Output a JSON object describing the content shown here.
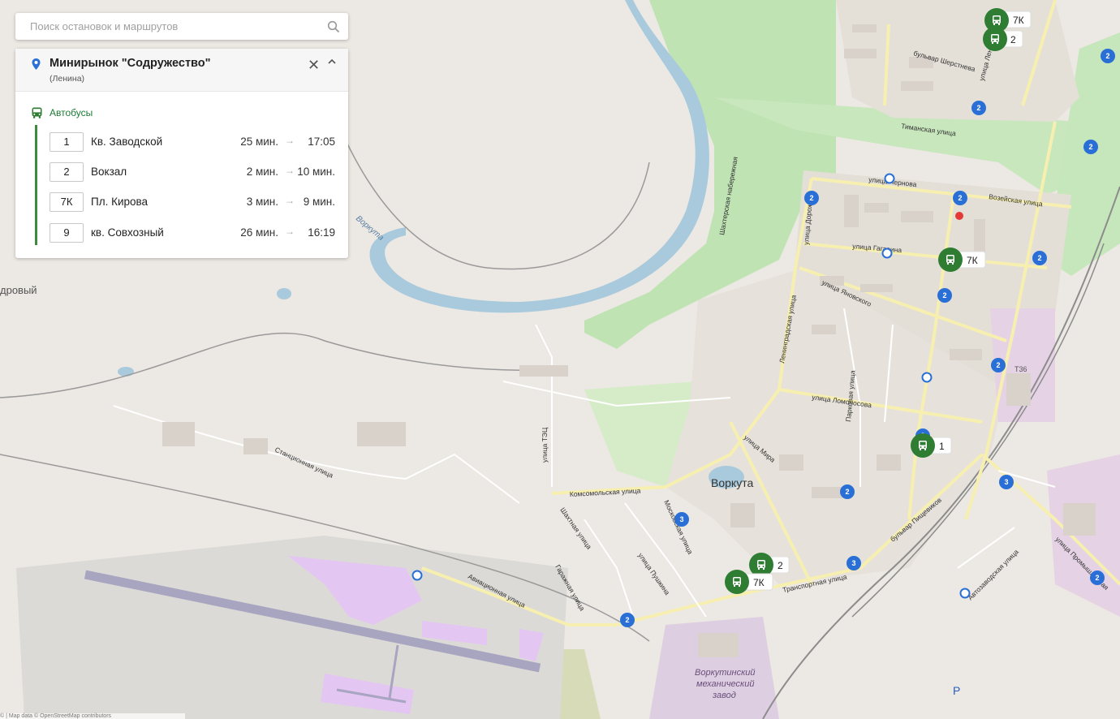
{
  "search": {
    "placeholder": "Поиск остановок и маршрутов",
    "icon": "search-icon"
  },
  "stop": {
    "title": "Минирынок \"Содружество\"",
    "subtitle": "(Ленина)",
    "section_label": "Автобусы",
    "routes": [
      {
        "number": "1",
        "destination": "Кв. Заводской",
        "next": "25 мин.",
        "after": "17:05"
      },
      {
        "number": "2",
        "destination": "Вокзал",
        "next": "2 мин.",
        "after": "10 мин."
      },
      {
        "number": "7К",
        "destination": "Пл. Кирова",
        "next": "3 мин.",
        "after": "9 мин."
      },
      {
        "number": "9",
        "destination": "кв. Совхозный",
        "next": "26 мин.",
        "after": "16:19"
      }
    ]
  },
  "map": {
    "city_label": "Воркута",
    "river_label": "Воркута",
    "district_label": "дровый",
    "factory_label": [
      "Воркутинский",
      "механический",
      "завод"
    ],
    "parking_label": "P",
    "code_label": "Т36",
    "streets": [
      "бульвар Шерстнева",
      "улица Ленина",
      "Тиманская улица",
      "улица Чернова",
      "Возейская улица",
      "улица Гагарина",
      "улица Яновского",
      "Шахтерская набережная",
      "Ленинградская улица",
      "Парковая улица",
      "улица Ломоносова",
      "бульвар Пищевиков",
      "улица Мира",
      "Комсомольская улица",
      "Московская улица",
      "улица Пушкина",
      "Шахтная улица",
      "Гаражная улица",
      "Транспортная улица",
      "Авиационная улица",
      "Станционная улица",
      "улица ТЭЦ",
      "Автозаводская улица",
      "улица Промышленная",
      "улица Дорожная"
    ],
    "bus_markers": [
      {
        "route": "7К"
      },
      {
        "route": "2"
      },
      {
        "route": "7К"
      },
      {
        "route": "1"
      },
      {
        "route": "2"
      },
      {
        "route": "7К"
      }
    ],
    "cluster_badges": [
      "2",
      "2",
      "2",
      "2",
      "2",
      "2",
      "2",
      "2",
      "2",
      "3",
      "2",
      "3",
      "3",
      "2",
      "2"
    ],
    "colors": {
      "bus_marker": "#2e7d32",
      "badge": "#2a6fd6",
      "water": "#a7c9dc",
      "forest": "#b8e0b0",
      "industrial": "#e1d0e3",
      "airport": "#ddc0f0",
      "road": "#fdf8c9"
    }
  },
  "attribution": "© | Map data © OpenStreetMap contributors"
}
